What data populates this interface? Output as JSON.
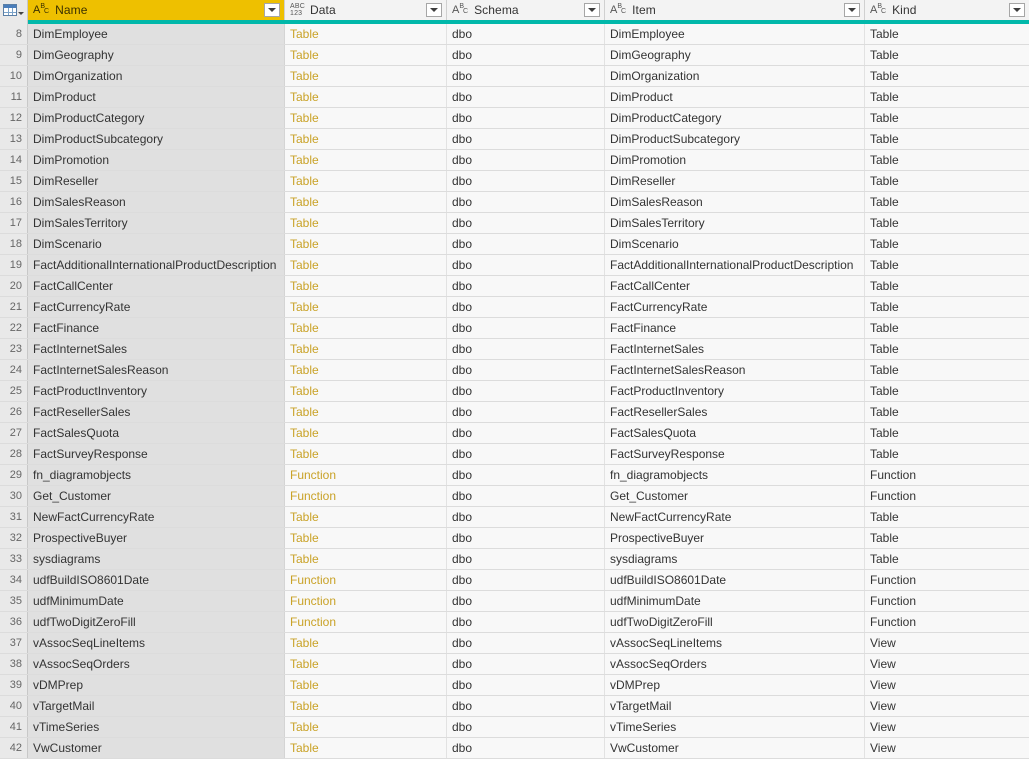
{
  "header": {
    "select_all_icon": "table-grid-icon",
    "columns": [
      {
        "key": "name",
        "label": "Name",
        "type_icon": "abc-text-type-icon",
        "type_label": "ABC",
        "has_filter": true,
        "selected": true
      },
      {
        "key": "data",
        "label": "Data",
        "type_icon": "any-type-icon",
        "type_label": "ABC123",
        "has_filter": true,
        "selected": false
      },
      {
        "key": "schema",
        "label": "Schema",
        "type_icon": "abc-text-type-icon",
        "type_label": "ABC",
        "has_filter": true,
        "selected": false
      },
      {
        "key": "item",
        "label": "Item",
        "type_icon": "abc-text-type-icon",
        "type_label": "ABC",
        "has_filter": true,
        "selected": false
      },
      {
        "key": "kind",
        "label": "Kind",
        "type_icon": "abc-text-type-icon",
        "type_label": "ABC",
        "has_filter": true,
        "selected": false
      }
    ]
  },
  "colors": {
    "selected_header": "#eec000",
    "accent_bar": "#01b8aa",
    "link_text": "#c9a227",
    "selected_column": "#e0e0e0",
    "row_background": "#f8f8f8",
    "gutter_background": "#e9e9e9"
  },
  "rows": [
    {
      "n": "8",
      "name": "DimEmployee",
      "data": "Table",
      "schema": "dbo",
      "item": "DimEmployee",
      "kind": "Table"
    },
    {
      "n": "9",
      "name": "DimGeography",
      "data": "Table",
      "schema": "dbo",
      "item": "DimGeography",
      "kind": "Table"
    },
    {
      "n": "10",
      "name": "DimOrganization",
      "data": "Table",
      "schema": "dbo",
      "item": "DimOrganization",
      "kind": "Table"
    },
    {
      "n": "11",
      "name": "DimProduct",
      "data": "Table",
      "schema": "dbo",
      "item": "DimProduct",
      "kind": "Table"
    },
    {
      "n": "12",
      "name": "DimProductCategory",
      "data": "Table",
      "schema": "dbo",
      "item": "DimProductCategory",
      "kind": "Table"
    },
    {
      "n": "13",
      "name": "DimProductSubcategory",
      "data": "Table",
      "schema": "dbo",
      "item": "DimProductSubcategory",
      "kind": "Table"
    },
    {
      "n": "14",
      "name": "DimPromotion",
      "data": "Table",
      "schema": "dbo",
      "item": "DimPromotion",
      "kind": "Table"
    },
    {
      "n": "15",
      "name": "DimReseller",
      "data": "Table",
      "schema": "dbo",
      "item": "DimReseller",
      "kind": "Table"
    },
    {
      "n": "16",
      "name": "DimSalesReason",
      "data": "Table",
      "schema": "dbo",
      "item": "DimSalesReason",
      "kind": "Table"
    },
    {
      "n": "17",
      "name": "DimSalesTerritory",
      "data": "Table",
      "schema": "dbo",
      "item": "DimSalesTerritory",
      "kind": "Table"
    },
    {
      "n": "18",
      "name": "DimScenario",
      "data": "Table",
      "schema": "dbo",
      "item": "DimScenario",
      "kind": "Table"
    },
    {
      "n": "19",
      "name": "FactAdditionalInternationalProductDescription",
      "data": "Table",
      "schema": "dbo",
      "item": "FactAdditionalInternationalProductDescription",
      "kind": "Table"
    },
    {
      "n": "20",
      "name": "FactCallCenter",
      "data": "Table",
      "schema": "dbo",
      "item": "FactCallCenter",
      "kind": "Table"
    },
    {
      "n": "21",
      "name": "FactCurrencyRate",
      "data": "Table",
      "schema": "dbo",
      "item": "FactCurrencyRate",
      "kind": "Table"
    },
    {
      "n": "22",
      "name": "FactFinance",
      "data": "Table",
      "schema": "dbo",
      "item": "FactFinance",
      "kind": "Table"
    },
    {
      "n": "23",
      "name": "FactInternetSales",
      "data": "Table",
      "schema": "dbo",
      "item": "FactInternetSales",
      "kind": "Table"
    },
    {
      "n": "24",
      "name": "FactInternetSalesReason",
      "data": "Table",
      "schema": "dbo",
      "item": "FactInternetSalesReason",
      "kind": "Table"
    },
    {
      "n": "25",
      "name": "FactProductInventory",
      "data": "Table",
      "schema": "dbo",
      "item": "FactProductInventory",
      "kind": "Table"
    },
    {
      "n": "26",
      "name": "FactResellerSales",
      "data": "Table",
      "schema": "dbo",
      "item": "FactResellerSales",
      "kind": "Table"
    },
    {
      "n": "27",
      "name": "FactSalesQuota",
      "data": "Table",
      "schema": "dbo",
      "item": "FactSalesQuota",
      "kind": "Table"
    },
    {
      "n": "28",
      "name": "FactSurveyResponse",
      "data": "Table",
      "schema": "dbo",
      "item": "FactSurveyResponse",
      "kind": "Table"
    },
    {
      "n": "29",
      "name": "fn_diagramobjects",
      "data": "Function",
      "schema": "dbo",
      "item": "fn_diagramobjects",
      "kind": "Function"
    },
    {
      "n": "30",
      "name": "Get_Customer",
      "data": "Function",
      "schema": "dbo",
      "item": "Get_Customer",
      "kind": "Function"
    },
    {
      "n": "31",
      "name": "NewFactCurrencyRate",
      "data": "Table",
      "schema": "dbo",
      "item": "NewFactCurrencyRate",
      "kind": "Table"
    },
    {
      "n": "32",
      "name": "ProspectiveBuyer",
      "data": "Table",
      "schema": "dbo",
      "item": "ProspectiveBuyer",
      "kind": "Table"
    },
    {
      "n": "33",
      "name": "sysdiagrams",
      "data": "Table",
      "schema": "dbo",
      "item": "sysdiagrams",
      "kind": "Table"
    },
    {
      "n": "34",
      "name": "udfBuildISO8601Date",
      "data": "Function",
      "schema": "dbo",
      "item": "udfBuildISO8601Date",
      "kind": "Function"
    },
    {
      "n": "35",
      "name": "udfMinimumDate",
      "data": "Function",
      "schema": "dbo",
      "item": "udfMinimumDate",
      "kind": "Function"
    },
    {
      "n": "36",
      "name": "udfTwoDigitZeroFill",
      "data": "Function",
      "schema": "dbo",
      "item": "udfTwoDigitZeroFill",
      "kind": "Function"
    },
    {
      "n": "37",
      "name": "vAssocSeqLineItems",
      "data": "Table",
      "schema": "dbo",
      "item": "vAssocSeqLineItems",
      "kind": "View"
    },
    {
      "n": "38",
      "name": "vAssocSeqOrders",
      "data": "Table",
      "schema": "dbo",
      "item": "vAssocSeqOrders",
      "kind": "View"
    },
    {
      "n": "39",
      "name": "vDMPrep",
      "data": "Table",
      "schema": "dbo",
      "item": "vDMPrep",
      "kind": "View"
    },
    {
      "n": "40",
      "name": "vTargetMail",
      "data": "Table",
      "schema": "dbo",
      "item": "vTargetMail",
      "kind": "View"
    },
    {
      "n": "41",
      "name": "vTimeSeries",
      "data": "Table",
      "schema": "dbo",
      "item": "vTimeSeries",
      "kind": "View"
    },
    {
      "n": "42",
      "name": "VwCustomer",
      "data": "Table",
      "schema": "dbo",
      "item": "VwCustomer",
      "kind": "View"
    }
  ]
}
